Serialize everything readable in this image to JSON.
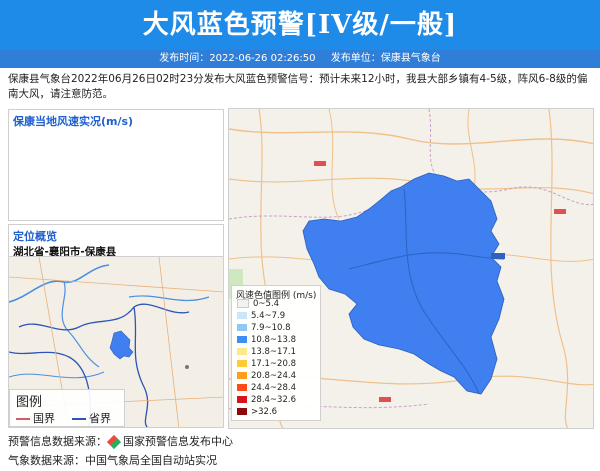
{
  "header": {
    "title": "大风蓝色预警[IV级/一般]",
    "publish_time": "发布时间：2022-06-26 02:26:50",
    "publisher": "发布单位：保康县气象台"
  },
  "description": "保康县气象台2022年06月26日02时23分发布大风蓝色预警信号：预计未来12小时，我县大部乡镇有4-5级，阵风6-8级的偏南大风，请注意防范。",
  "wind_panel": {
    "title": "保康当地风速实况(m/s)"
  },
  "location_panel": {
    "title": "定位概览",
    "path": "湖北省-襄阳市-保康县"
  },
  "small_map_legend": {
    "title": "图例",
    "items": [
      {
        "label": "国界",
        "color": "#d25a6c"
      },
      {
        "label": "省界",
        "color": "#2c55b8"
      }
    ]
  },
  "wind_legend": {
    "title": "风速色值图例 (m/s)",
    "items": [
      {
        "label": "0~5.4",
        "color": "#f2f2f2"
      },
      {
        "label": "5.4~7.9",
        "color": "#c9e6fb"
      },
      {
        "label": "7.9~10.8",
        "color": "#8fc8f4"
      },
      {
        "label": "10.8~13.8",
        "color": "#3f8ff0"
      },
      {
        "label": "13.8~17.1",
        "color": "#ffe88a"
      },
      {
        "label": "17.1~20.8",
        "color": "#ffcc33"
      },
      {
        "label": "20.8~24.4",
        "color": "#ff9e1a"
      },
      {
        "label": "24.4~28.4",
        "color": "#ff4a1a"
      },
      {
        "label": "28.4~32.6",
        "color": "#d4141a"
      },
      {
        "label": ">32.6",
        "color": "#8a0a0a"
      }
    ]
  },
  "footer": {
    "source_warning_label": "预警信息数据来源：",
    "source_warning_value": "国家预警信息发布中心",
    "source_weather": "气象数据来源：中国气象局全国自动站实况"
  },
  "colors": {
    "banner": "#1e8be8",
    "meta_bar": "#2f7fd8",
    "region_fill": "#3f7ff0",
    "panel_title": "#1f5fd0"
  }
}
